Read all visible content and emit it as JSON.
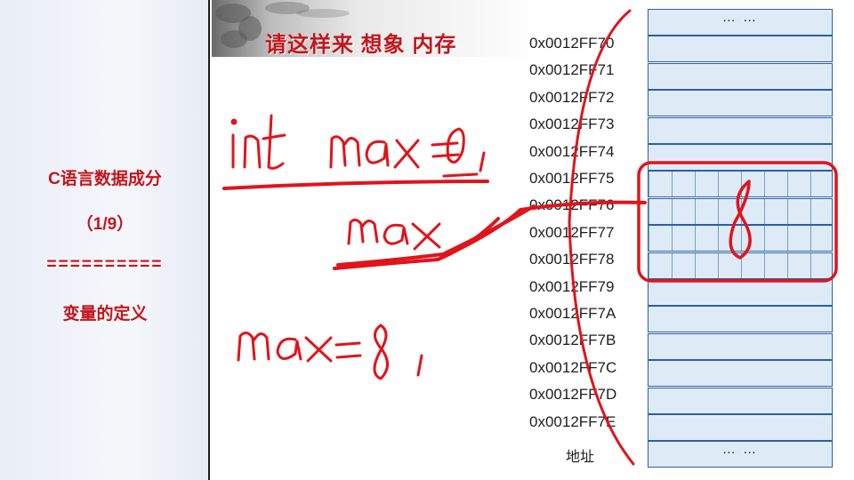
{
  "sidebar": {
    "title": "C语言数据成分",
    "page": "（1/9）",
    "divider": "==========",
    "subtitle": "变量的定义"
  },
  "slide": {
    "title": "请这样来 想象 内存",
    "address_caption": "地址",
    "addresses": [
      "0x0012FF70",
      "0x0012FF71",
      "0x0012FF72",
      "0x0012FF73",
      "0x0012FF74",
      "0x0012FF75",
      "0x0012FF76",
      "0x0012FF77",
      "0x0012FF78",
      "0x0012FF79",
      "0x0012FF7A",
      "0x0012FF7B",
      "0x0012FF7C",
      "0x0012FF7D",
      "0x0012FF7E"
    ],
    "memory_top_ellipsis": "… …",
    "memory_bottom_ellipsis": "… …",
    "handwriting": {
      "declaration": "int max = 0 ;",
      "variable_name": "max",
      "assignment": "max = 8 ;",
      "cell_value": "8"
    }
  },
  "colors": {
    "accent_red": "#c4161c",
    "memory_fill": "#deebf7",
    "memory_border": "#2a5fa6"
  }
}
